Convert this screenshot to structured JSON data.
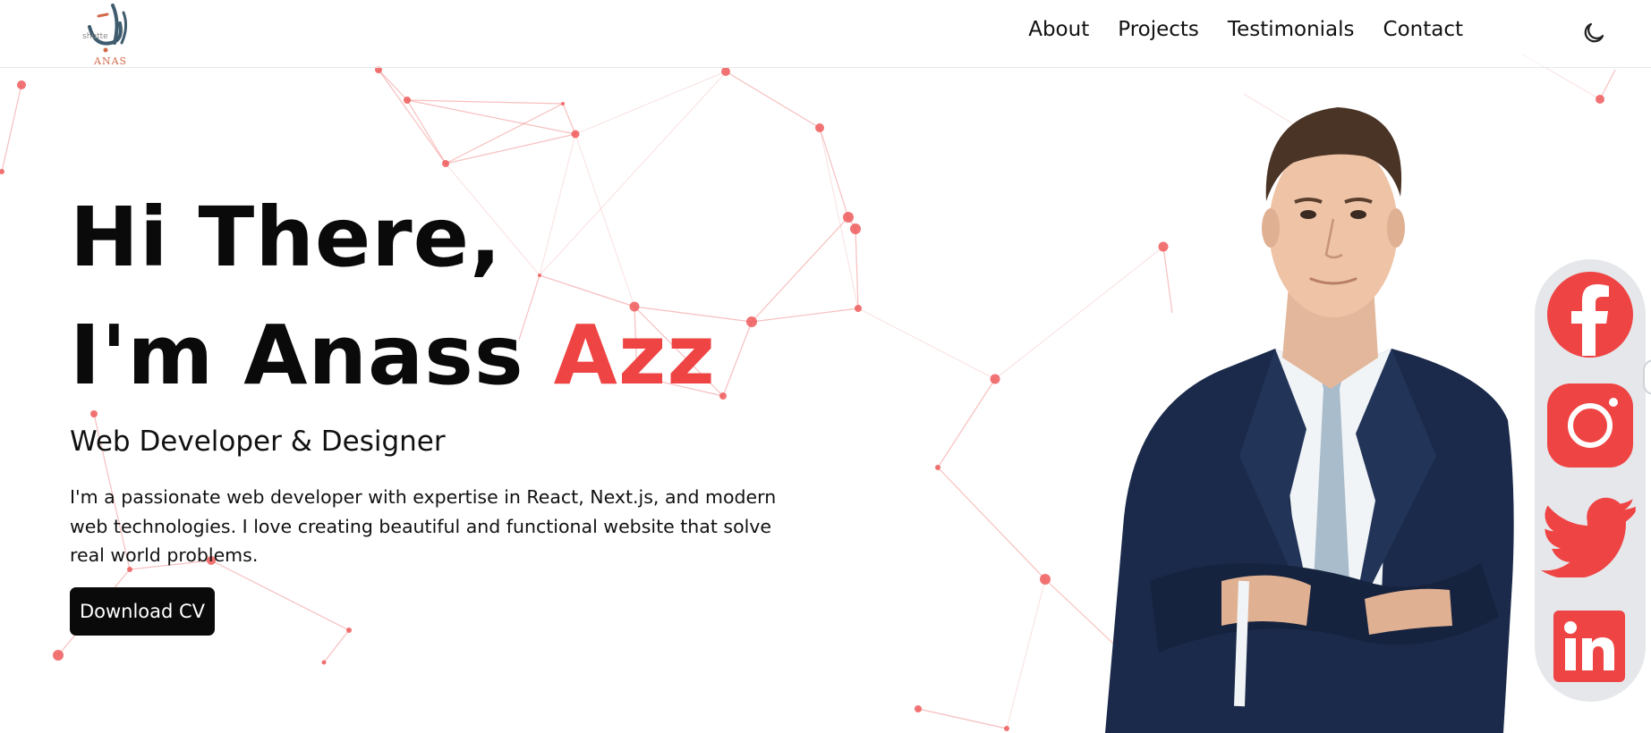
{
  "brand": {
    "logo_script": "نأس",
    "logo_name": "ANAS",
    "logo_watermark": "shutte"
  },
  "nav": {
    "items": [
      {
        "label": "About"
      },
      {
        "label": "Projects"
      },
      {
        "label": "Testimonials"
      },
      {
        "label": "Contact"
      }
    ],
    "theme_icon": "moon-icon"
  },
  "hero": {
    "greeting": "Hi There,",
    "intro_prefix": "I'm Anass ",
    "intro_highlight": "Azz",
    "role": "Web Developer & Designer",
    "bio": "I'm a passionate web developer with expertise in React, Next.js, and modern web technologies. I love creating beautiful and functional website that solve real world problems.",
    "cta_label": "Download CV"
  },
  "social": [
    {
      "name": "Facebook",
      "icon": "facebook-icon"
    },
    {
      "name": "Instagram",
      "icon": "instagram-icon"
    },
    {
      "name": "Twitter",
      "icon": "twitter-icon"
    },
    {
      "name": "LinkedIn",
      "icon": "linkedin-icon"
    }
  ],
  "colors": {
    "accent": "#ef4444",
    "text": "#0a0a0a",
    "rail": "#e5e7eb",
    "suit": "#1b2a4a"
  }
}
